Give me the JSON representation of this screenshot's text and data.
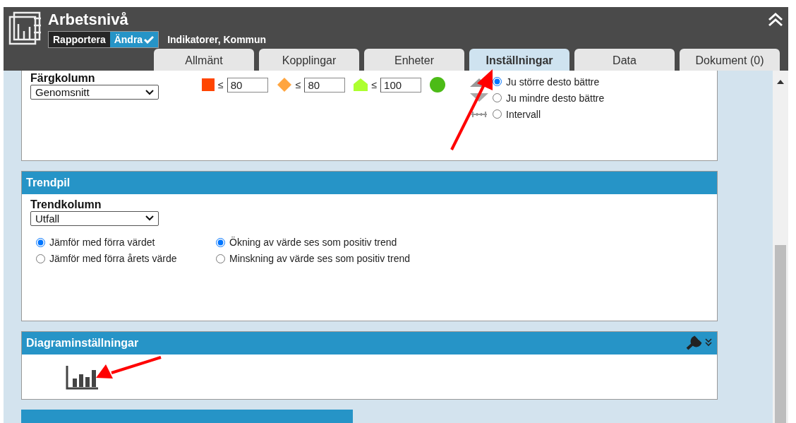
{
  "header": {
    "title": "Arbetsnivå",
    "modes": [
      {
        "label": "Rapportera",
        "selected": false
      },
      {
        "label": "Ändra",
        "selected": true
      }
    ],
    "context": "Indikatorer, Kommun"
  },
  "tabs": [
    {
      "label": "Allmänt",
      "selected": false
    },
    {
      "label": "Kopplingar",
      "selected": false
    },
    {
      "label": "Enheter",
      "selected": false
    },
    {
      "label": "Inställningar",
      "selected": true
    },
    {
      "label": "Data",
      "selected": false
    },
    {
      "label": "Dokument (0)",
      "selected": false
    }
  ],
  "color_panel": {
    "column_label": "Färgkolumn",
    "column_value": "Genomsnitt",
    "thresholds": [
      {
        "kind": "square",
        "color": "#ff4500",
        "symbol": "≤",
        "value": "80"
      },
      {
        "kind": "diamond",
        "color": "#ffa540",
        "symbol": "≤",
        "value": "80"
      },
      {
        "kind": "pentagon",
        "color": "#adff2f",
        "symbol": "≤",
        "value": "100"
      },
      {
        "kind": "circle",
        "color": "#4cbb17"
      }
    ],
    "direction": [
      {
        "kind": "up-down",
        "label": "Ju större desto bättre",
        "selected": true
      },
      {
        "kind": "down",
        "label": "Ju mindre desto bättre",
        "selected": false
      },
      {
        "kind": "interval",
        "label": "Intervall",
        "selected": false
      }
    ]
  },
  "trend_panel": {
    "title": "Trendpil",
    "column_label": "Trendkolumn",
    "column_value": "Utfall",
    "compare": [
      {
        "label": "Jämför med förra värdet",
        "selected": true
      },
      {
        "label": "Jämför med förra årets värde",
        "selected": false
      }
    ],
    "polarity": [
      {
        "label": "Ökning av värde ses som positiv trend",
        "selected": true
      },
      {
        "label": "Minskning av värde ses som positiv trend",
        "selected": false
      }
    ]
  },
  "chart_panel": {
    "title": "Diagraminställningar"
  }
}
